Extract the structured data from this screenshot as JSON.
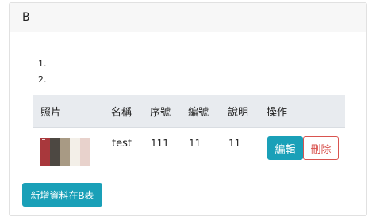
{
  "card": {
    "title": "B"
  },
  "list": {
    "items": [
      {
        "number": "1.",
        "text": ""
      },
      {
        "number": "2.",
        "text": ""
      }
    ]
  },
  "table": {
    "headers": [
      "照片",
      "名稱",
      "序號",
      "編號",
      "說明",
      "操作"
    ],
    "rows": [
      {
        "photo_icon": "color-palette-thumbnail",
        "photo_colors": [
          "#a8383c",
          "#4d4842",
          "#a89a84",
          "#f3efe8",
          "#e8d2cc"
        ],
        "name": "test",
        "seq": "111",
        "code": "11",
        "desc": "11",
        "edit_label": "編輯",
        "delete_label": "刪除"
      }
    ]
  },
  "actions": {
    "add_label": "新增資料在B表"
  },
  "colors": {
    "primary": "#1aa0b8",
    "danger": "#d9534f",
    "header_bg": "#f7f7f7",
    "table_head_bg": "#e8ebef"
  }
}
